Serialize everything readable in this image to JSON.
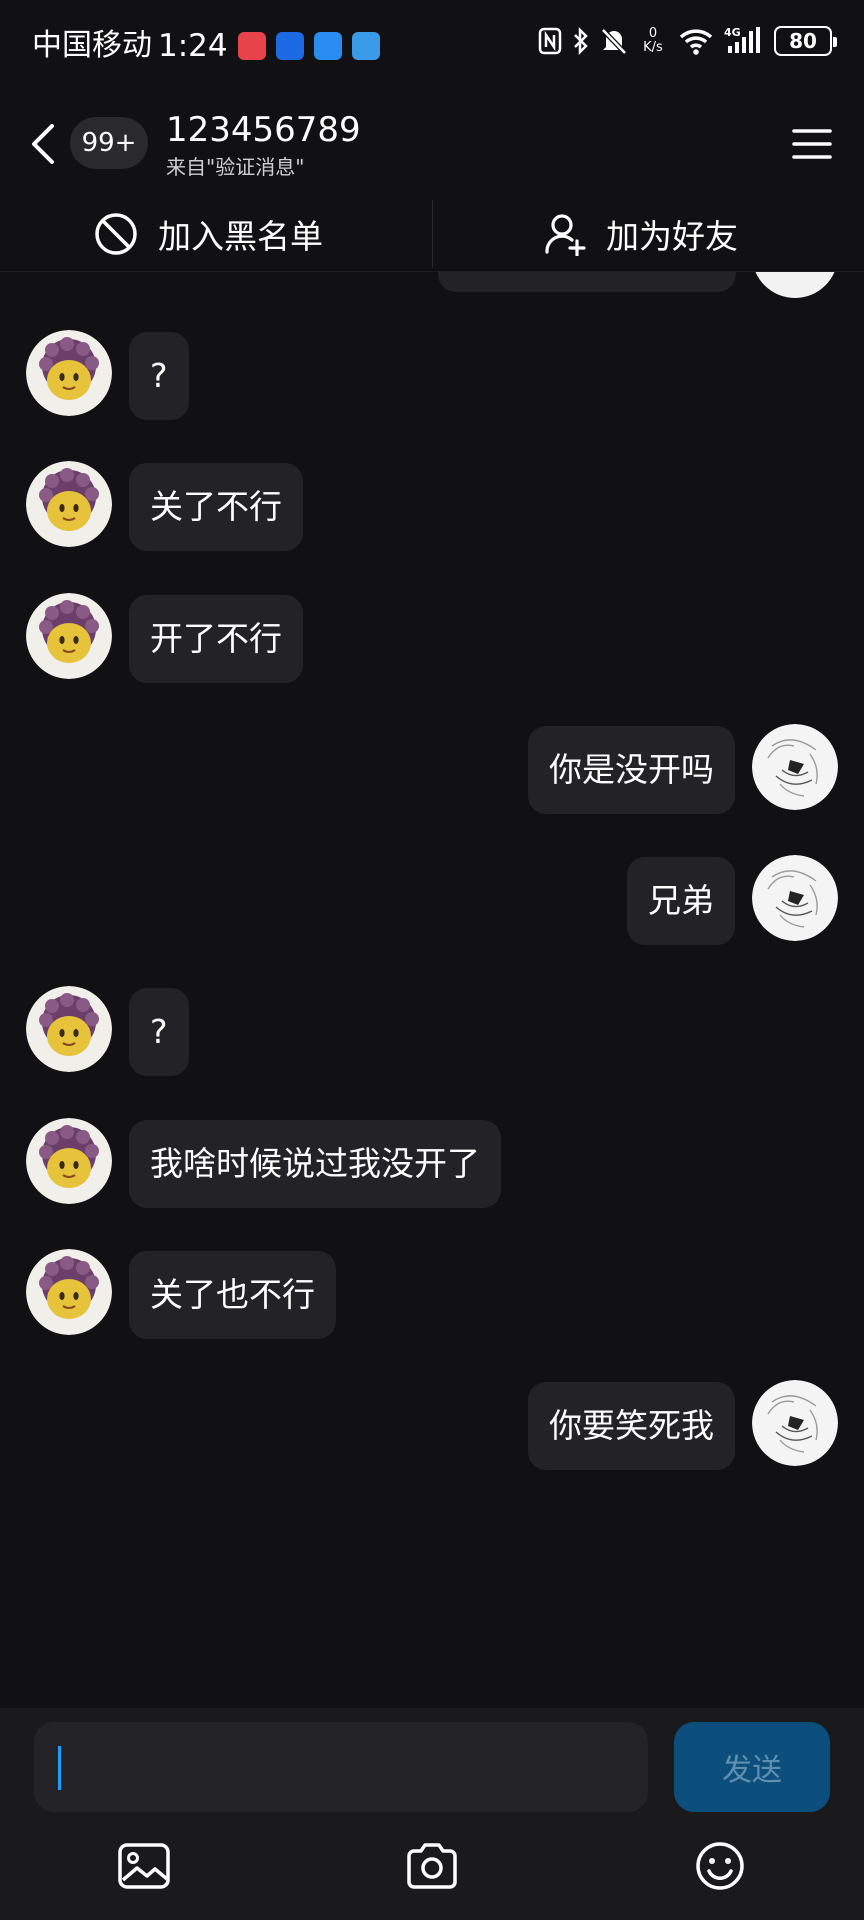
{
  "status_bar": {
    "carrier": "中国移动",
    "time": "1:24",
    "net_speed_value": "0",
    "net_speed_unit": "K/s",
    "battery": "80"
  },
  "header": {
    "unread_badge": "99+",
    "contact_name": "123456789",
    "subtitle": "来自\"验证消息\""
  },
  "actions": {
    "block": "加入黑名单",
    "add_friend": "加为好友"
  },
  "messages": [
    {
      "side": "left",
      "text": "?"
    },
    {
      "side": "left",
      "text": "关了不行"
    },
    {
      "side": "left",
      "text": "开了不行"
    },
    {
      "side": "right",
      "text": "你是没开吗"
    },
    {
      "side": "right",
      "text": "兄弟"
    },
    {
      "side": "left",
      "text": "?"
    },
    {
      "side": "left",
      "text": "我啥时候说过我没开了"
    },
    {
      "side": "left",
      "text": "关了也不行"
    },
    {
      "side": "right",
      "text": "你要笑死我"
    }
  ],
  "input": {
    "placeholder": "",
    "send_label": "发送"
  },
  "colors": {
    "background": "#111113",
    "bubble": "#232327",
    "send_button": "#0d4f7c",
    "cursor": "#1aa0ff"
  },
  "icons": [
    "back-icon",
    "menu-icon",
    "block-icon",
    "add-friend-icon",
    "image-icon",
    "camera-icon",
    "emoji-icon"
  ]
}
